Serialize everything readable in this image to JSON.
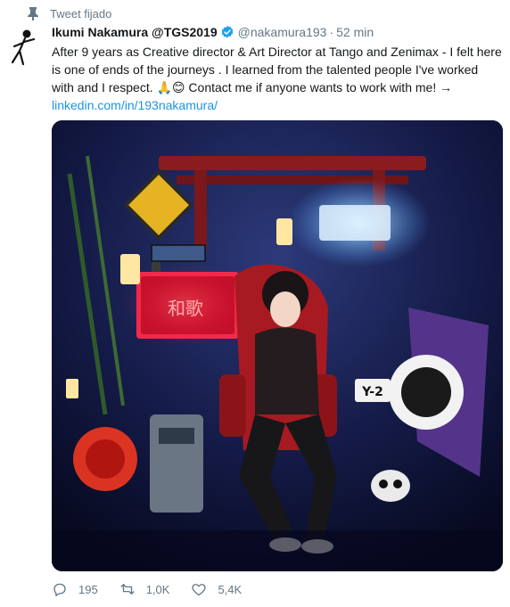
{
  "pinned": {
    "label": "Tweet fijado"
  },
  "tweet": {
    "author_name": "Ikumi Nakamura @TGS2019",
    "handle": "@nakamura193",
    "separator": "·",
    "time": "52 min",
    "text_main": "After 9  years as Creative director & Art Director at Tango and Zenimax - I felt here is one of ends of the journeys . I learned from the talented people I've worked with and I respect. 🙏😊  Contact me if anyone wants to work with me! →",
    "link": "linkedin.com/in/193nakamura/"
  },
  "media": {
    "sign_text": "和歌",
    "badge_text": "Y-2",
    "colors": {
      "background": "#0d1130",
      "neon_red": "#ff2a4a",
      "neon_blue": "#7fd0ff",
      "torii": "#8a1c20"
    }
  },
  "actions": {
    "reply_count": "195",
    "retweet_count": "1,0K",
    "like_count": "5,4K"
  },
  "colors": {
    "link": "#1b95e0",
    "secondary": "#657786",
    "verified": "#1da1f2"
  }
}
